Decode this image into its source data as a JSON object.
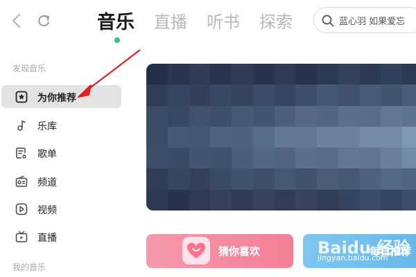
{
  "header": {
    "tabs": [
      {
        "label": "音乐",
        "active": true
      },
      {
        "label": "直播",
        "active": false
      },
      {
        "label": "听书",
        "active": false
      },
      {
        "label": "探索",
        "active": false
      }
    ],
    "search_text": "蓝心羽 如果爱忘"
  },
  "sidebar": {
    "section1_title": "发现音乐",
    "items": [
      {
        "label": "为你推荐",
        "icon": "star-icon",
        "active": true
      },
      {
        "label": "乐库",
        "icon": "music-note-icon",
        "active": false
      },
      {
        "label": "歌单",
        "icon": "playlist-icon",
        "active": false
      },
      {
        "label": "频道",
        "icon": "radio-icon",
        "active": false
      },
      {
        "label": "视频",
        "icon": "video-icon",
        "active": false
      },
      {
        "label": "直播",
        "icon": "tv-icon",
        "active": false
      }
    ],
    "section2_title": "我的音乐"
  },
  "cards": {
    "guess_label": "猜你喜欢",
    "daily_label": "每日推荐"
  },
  "watermark": {
    "main": "Baidu 经验",
    "sub": "jingyan.baidu.com"
  },
  "colors": {
    "accent_green": "#31c27c",
    "annotation_red": "#e02020"
  }
}
